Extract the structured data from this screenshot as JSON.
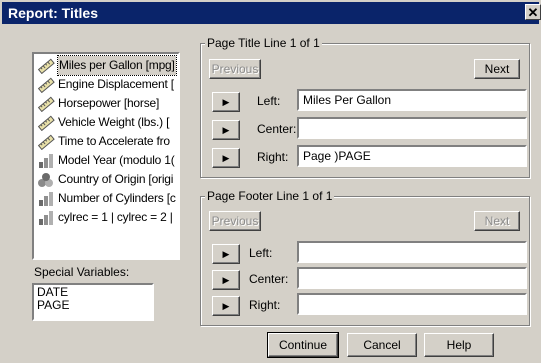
{
  "window": {
    "title": "Report: Titles",
    "close_glyph": "✕"
  },
  "variables": {
    "items": [
      {
        "label": "Miles per Gallon [mpg]",
        "icon": "scale-ruler-icon"
      },
      {
        "label": "Engine Displacement [",
        "icon": "scale-ruler-icon"
      },
      {
        "label": "Horsepower [horse]",
        "icon": "scale-ruler-icon"
      },
      {
        "label": "Vehicle Weight (lbs.) [",
        "icon": "scale-ruler-icon"
      },
      {
        "label": "Time to Accelerate fro",
        "icon": "scale-ruler-icon"
      },
      {
        "label": "Model Year (modulo 1(",
        "icon": "ordinal-bars-icon"
      },
      {
        "label": "Country of Origin [origi",
        "icon": "nominal-shapes-icon"
      },
      {
        "label": "Number of Cylinders [c",
        "icon": "ordinal-bars-icon"
      },
      {
        "label": "cylrec = 1 | cylrec = 2 |",
        "icon": "ordinal-bars-icon"
      }
    ],
    "selected_index": 0
  },
  "special": {
    "label": "Special Variables:",
    "items": [
      "DATE",
      "PAGE"
    ]
  },
  "page_title": {
    "legend": "Page Title Line 1 of 1",
    "previous": "Previous",
    "next": "Next",
    "fields": [
      {
        "label": "Left:",
        "value": "Miles Per Gallon"
      },
      {
        "label": "Center:",
        "value": ""
      },
      {
        "label": "Right:",
        "value": "Page )PAGE"
      }
    ]
  },
  "page_footer": {
    "legend": "Page Footer Line 1 of 1",
    "previous": "Previous",
    "next": "Next",
    "fields": [
      {
        "label": "Left:",
        "value": ""
      },
      {
        "label": "Center:",
        "value": ""
      },
      {
        "label": "Right:",
        "value": ""
      }
    ]
  },
  "buttons": {
    "continue": "Continue",
    "cancel": "Cancel",
    "help": "Help"
  },
  "arrow_glyph": "▶"
}
